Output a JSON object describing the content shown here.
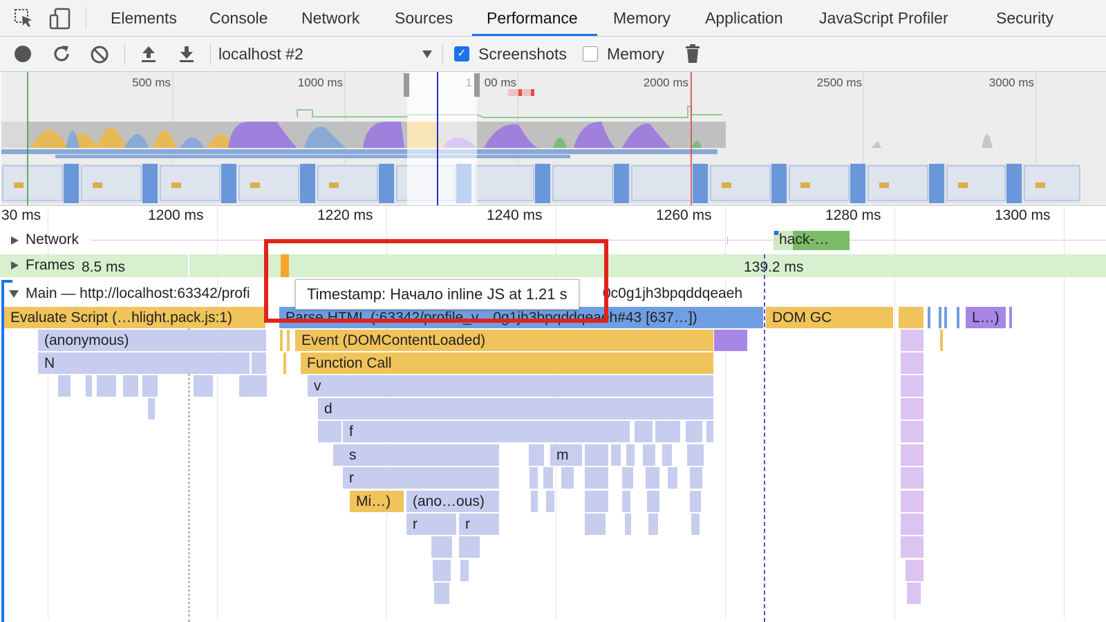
{
  "tabs": [
    "Elements",
    "Console",
    "Network",
    "Sources",
    "Performance",
    "Memory",
    "Application",
    "JavaScript Profiler",
    "Security"
  ],
  "active_tab": "Performance",
  "toolbar": {
    "target_select": "localhost #2",
    "screenshots_label": "Screenshots",
    "screenshots_checked": true,
    "memory_label": "Memory",
    "memory_checked": false
  },
  "overview": {
    "ticks": [
      "500 ms",
      "1000 ms",
      "1",
      "00 ms",
      "2000 ms",
      "2500 ms",
      "3000 ms"
    ]
  },
  "ruler": {
    "ticks": [
      "30 ms",
      "1200 ms",
      "1220 ms",
      "1240 ms",
      "1260 ms",
      "1280 ms",
      "1300 ms"
    ]
  },
  "tracks": {
    "network_label": "Network",
    "network_request": "hack-…",
    "frames_label": "Frames",
    "frame_time_1": "8.5 ms",
    "frame_time_2": "139.2 ms",
    "main_label": "Main — http://localhost:63342/profi",
    "main_label_tail": "0c0g1jh3bpqddqeaeh"
  },
  "flame": {
    "evaluate_script": "Evaluate Script (…hlight.pack.js:1)",
    "parse_html": "Parse HTML (:63342/profile_v…0g1jh3bpqddqeaeh#43 [637…])",
    "dom_gc": "DOM GC",
    "l_short": "L…)",
    "anonymous": "(anonymous)",
    "n": "N",
    "event_dcl": "Event (DOMContentLoaded)",
    "function_call": "Function Call",
    "v": "v",
    "d": "d",
    "f": "f",
    "s": "s",
    "m": "m",
    "r": "r",
    "mi": "Mi…)",
    "ano_ous": "(ano…ous)",
    "r2": "r",
    "r3": "r"
  },
  "tooltip": "Timestamp: Начало inline JS at 1.21 s"
}
